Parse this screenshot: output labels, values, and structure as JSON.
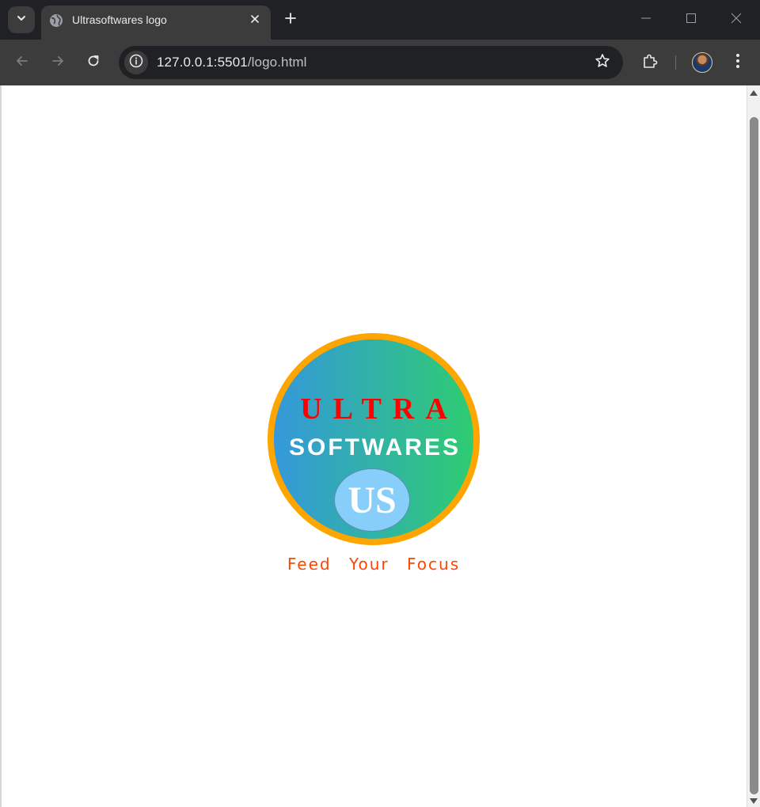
{
  "browser": {
    "tab": {
      "title": "Ultrasoftwares logo"
    },
    "address_bar": {
      "url_host": "127.0.0.1:5501",
      "url_path": "/logo.html"
    }
  },
  "logo": {
    "word_top": "ULTRA",
    "word_middle": "SOFTWARES",
    "monogram": "US",
    "tagline": "Feed Your Focus",
    "colors": {
      "ring": "#ffa500",
      "gradient_start": "#3498db",
      "gradient_end": "#2ecc71",
      "ultra_text": "#ff0000",
      "softwares_text": "#ffffff",
      "badge_fill": "#87cefa",
      "tagline_text": "#ff4500"
    }
  },
  "icons": {
    "tab_search": "chevron-down-icon",
    "favicon": "globe-icon",
    "tab_close": "close-icon",
    "new_tab": "plus-icon",
    "minimize": "minimize-icon",
    "maximize": "maximize-icon",
    "close_window": "close-window-icon",
    "back": "arrow-left-icon",
    "forward": "arrow-right-icon",
    "reload": "reload-icon",
    "site_info": "info-icon",
    "bookmark": "star-icon",
    "extensions": "puzzle-icon",
    "menu": "kebab-icon"
  }
}
